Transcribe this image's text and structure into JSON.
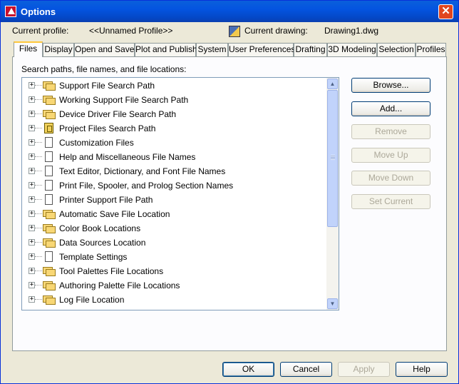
{
  "window": {
    "title": "Options",
    "close_glyph": "✕"
  },
  "profile": {
    "current_profile_label": "Current profile:",
    "current_profile_value": "<<Unnamed Profile>>",
    "current_drawing_label": "Current drawing:",
    "current_drawing_value": "Drawing1.dwg"
  },
  "tabs": [
    "Files",
    "Display",
    "Open and Save",
    "Plot and Publish",
    "System",
    "User Preferences",
    "Drafting",
    "3D Modeling",
    "Selection",
    "Profiles"
  ],
  "active_tab": "Files",
  "files_panel": {
    "label": "Search paths, file names, and file locations:",
    "tree_items": [
      {
        "label": "Support File Search Path",
        "icon": "folders-icon"
      },
      {
        "label": "Working Support File Search Path",
        "icon": "folders-icon"
      },
      {
        "label": "Device Driver File Search Path",
        "icon": "folders-icon"
      },
      {
        "label": "Project Files Search Path",
        "icon": "project-icon"
      },
      {
        "label": "Customization Files",
        "icon": "document-icon"
      },
      {
        "label": "Help and Miscellaneous File Names",
        "icon": "document-icon"
      },
      {
        "label": "Text Editor, Dictionary, and Font File Names",
        "icon": "document-icon"
      },
      {
        "label": "Print File, Spooler, and Prolog Section Names",
        "icon": "document-icon"
      },
      {
        "label": "Printer Support File Path",
        "icon": "document-icon"
      },
      {
        "label": "Automatic Save File Location",
        "icon": "folders-icon"
      },
      {
        "label": "Color Book Locations",
        "icon": "folders-icon"
      },
      {
        "label": "Data Sources Location",
        "icon": "folders-icon"
      },
      {
        "label": "Template Settings",
        "icon": "document-icon"
      },
      {
        "label": "Tool Palettes File Locations",
        "icon": "folders-icon"
      },
      {
        "label": "Authoring Palette File Locations",
        "icon": "folders-icon"
      },
      {
        "label": "Log File Location",
        "icon": "folders-icon"
      }
    ],
    "expander_glyph": "+",
    "scroll_up_glyph": "▲",
    "scroll_down_glyph": "▼",
    "buttons": {
      "browse": "Browse...",
      "add": "Add...",
      "remove": "Remove",
      "move_up": "Move Up",
      "move_down": "Move Down",
      "set_current": "Set Current"
    }
  },
  "footer": {
    "ok": "OK",
    "cancel": "Cancel",
    "apply": "Apply",
    "help": "Help"
  },
  "colors": {
    "titlebar": "#0454e0",
    "dialog_bg": "#ece9d8",
    "tab_highlight": "#ffc83c"
  }
}
